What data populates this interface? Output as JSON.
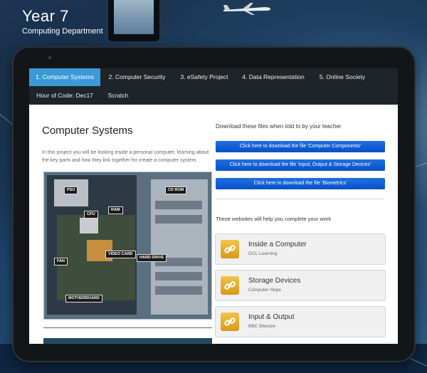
{
  "site": {
    "title": "Year 7",
    "subtitle": "Computing Department"
  },
  "nav": {
    "tabs": [
      {
        "label": "1. Computer Systems",
        "active": true
      },
      {
        "label": "2. Computer Security"
      },
      {
        "label": "3. eSafety Project"
      },
      {
        "label": "4. Data Representation"
      },
      {
        "label": "5. Online Society"
      },
      {
        "label": "Hour of Code: Dec17"
      },
      {
        "label": "Scratch"
      }
    ]
  },
  "page": {
    "heading": "Computer Systems",
    "intro": "In this project you will be looking inside a personal computer, learning about the key parts and how they link together for create a computer system.",
    "photo_labels": [
      "PSU",
      "CPU",
      "RAM",
      "CD ROM",
      "VIDEO CARD",
      "HARD DRIVE",
      "FAN",
      "MOTHERBOARD"
    ]
  },
  "downloads": {
    "heading": "Download these files when told to by your teacher",
    "buttons": [
      "Click here to download the file 'Computer Components'",
      "Click here to download the file 'Input, Output & Storage Devices'",
      "Click here to download the file 'Biometrics'"
    ]
  },
  "websites": {
    "heading": "These websites will help you complete your work",
    "items": [
      {
        "title": "Inside a Computer",
        "source": "GCL Learning",
        "icon": "link-icon"
      },
      {
        "title": "Storage Devices",
        "source": "Computer Hope",
        "icon": "link-icon"
      },
      {
        "title": "Input & Output",
        "source": "BBC Bitesize",
        "icon": "link-icon"
      }
    ]
  },
  "colors": {
    "active_tab": "#3b9ad6",
    "nav_bg": "#1f2428",
    "button_blue": "#0b5bd3",
    "link_icon": "#e4ab2c"
  }
}
